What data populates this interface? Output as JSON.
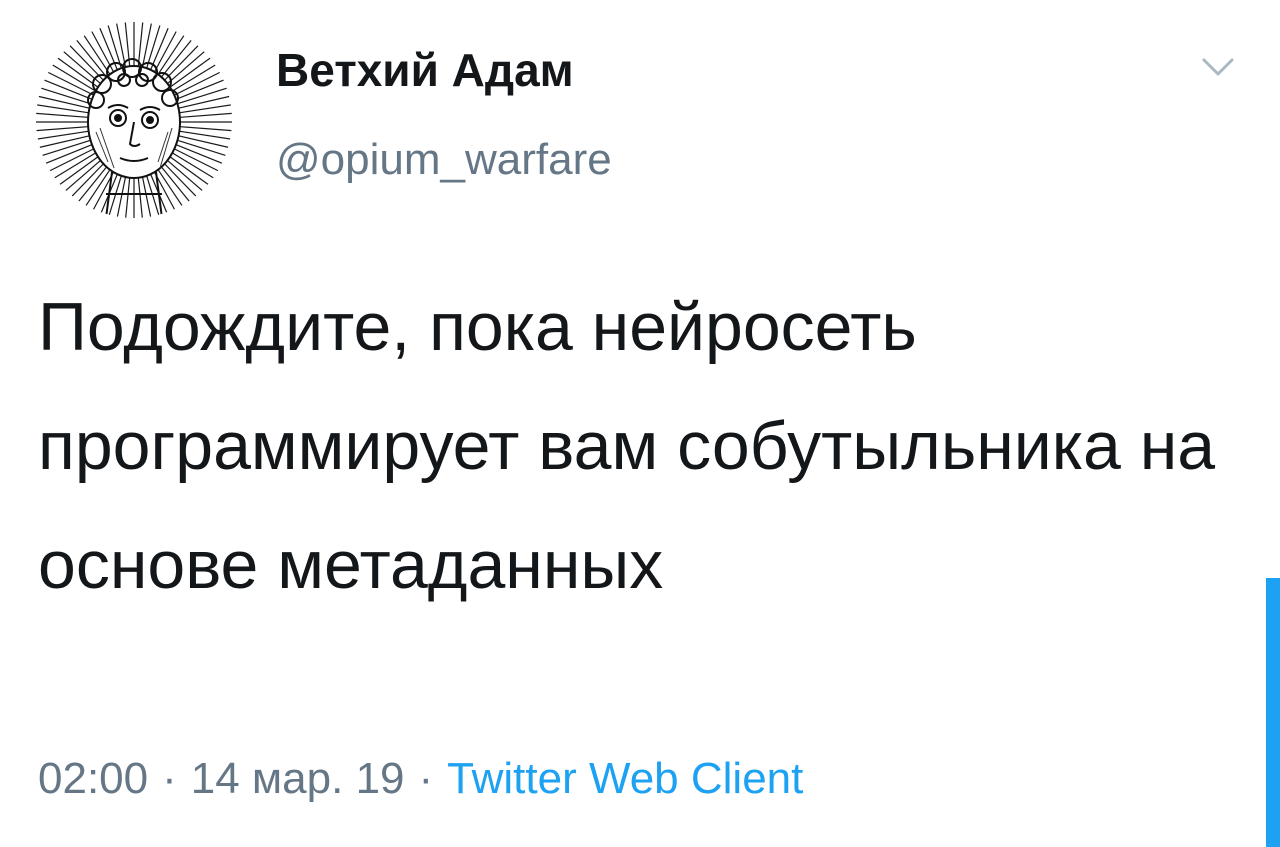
{
  "tweet": {
    "author": {
      "display_name": "Ветхий Адам",
      "handle": "@opium_warfare",
      "avatar_icon": "engraved-face-avatar"
    },
    "menu_icon": "chevron-down-icon",
    "text": "Подождите, пока нейросеть программирует вам собутыльника на основе метаданных",
    "time": "02:00",
    "separator": "·",
    "date": "14 мар. 19",
    "client": "Twitter Web Client"
  },
  "colors": {
    "text_primary": "#14171a",
    "text_secondary": "#657786",
    "accent": "#1da1f2",
    "background": "#ffffff"
  }
}
